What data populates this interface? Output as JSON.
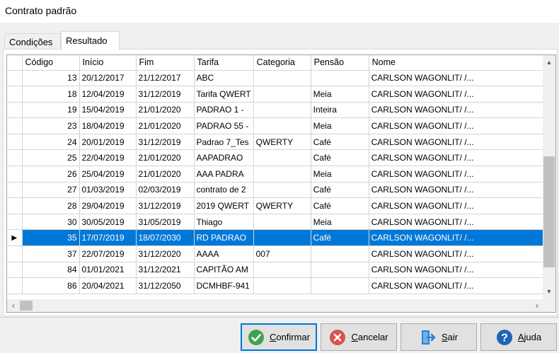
{
  "window": {
    "title": "Contrato padrão"
  },
  "tabs": [
    {
      "label": "Condições"
    },
    {
      "label": "Resultado"
    }
  ],
  "grid": {
    "columns": [
      "Código",
      "Início",
      "Fim",
      "Tarifa",
      "Categoria",
      "Pensão",
      "Nome"
    ],
    "rows": [
      [
        "13",
        "20/12/2017",
        "21/12/2017",
        "ABC",
        "",
        "",
        "CARLSON WAGONLIT/ /..."
      ],
      [
        "18",
        "12/04/2019",
        "31/12/2019",
        "Tarifa QWERT",
        "",
        "Meia",
        "CARLSON WAGONLIT/ /..."
      ],
      [
        "19",
        "15/04/2019",
        "21/01/2020",
        "PADRAO 1 -",
        "",
        "Inteira",
        "CARLSON WAGONLIT/ /..."
      ],
      [
        "23",
        "18/04/2019",
        "21/01/2020",
        "PADRAO 55 -",
        "",
        "Meia",
        "CARLSON WAGONLIT/ /..."
      ],
      [
        "24",
        "20/01/2019",
        "31/12/2019",
        "Padrao 7_Tes",
        "QWERTY",
        "Café",
        "CARLSON WAGONLIT/ /..."
      ],
      [
        "25",
        "22/04/2019",
        "21/01/2020",
        " AAPADRAO",
        "",
        "Café",
        "CARLSON WAGONLIT/ /..."
      ],
      [
        "26",
        "25/04/2019",
        "21/01/2020",
        "AAA PADRA",
        "",
        "Meia",
        "CARLSON WAGONLIT/ /..."
      ],
      [
        "27",
        "01/03/2019",
        "02/03/2019",
        "contrato de 2",
        "",
        "Café",
        "CARLSON WAGONLIT/ /..."
      ],
      [
        "28",
        "29/04/2019",
        "31/12/2019",
        "2019 QWERT",
        "QWERTY",
        "Café",
        "CARLSON WAGONLIT/ /..."
      ],
      [
        "30",
        "30/05/2019",
        "31/05/2019",
        "Thiago",
        "",
        "Meia",
        "CARLSON WAGONLIT/ /..."
      ],
      [
        "35",
        "17/07/2019",
        "18/07/2030",
        "RD PADRAO",
        "",
        "Café",
        "CARLSON WAGONLIT/ /..."
      ],
      [
        "37",
        "22/07/2019",
        "31/12/2020",
        "AAAA",
        "007",
        "",
        "CARLSON WAGONLIT/ /..."
      ],
      [
        "84",
        "01/01/2021",
        "31/12/2021",
        "CAPITÃO AM",
        "",
        "",
        "CARLSON WAGONLIT/ /..."
      ],
      [
        "86",
        "20/04/2021",
        "31/12/2050",
        "DCMHBF-941",
        "",
        "",
        "CARLSON WAGONLIT/ /..."
      ]
    ],
    "selected_row_code": "35",
    "row_indicator_symbol": "▶"
  },
  "buttons": {
    "confirm": {
      "label": "Confirmar",
      "icon": "check-circle-icon",
      "color": "#3fa34d"
    },
    "cancel": {
      "label": "Cancelar",
      "icon": "x-circle-icon",
      "color": "#d9534f"
    },
    "exit": {
      "label": "Sair",
      "icon": "exit-door-icon",
      "color": "#2a7fd4"
    },
    "help": {
      "label": "Ajuda",
      "icon": "help-circle-icon",
      "color": "#1f63b5"
    }
  },
  "colors": {
    "selection": "#0078d7"
  }
}
